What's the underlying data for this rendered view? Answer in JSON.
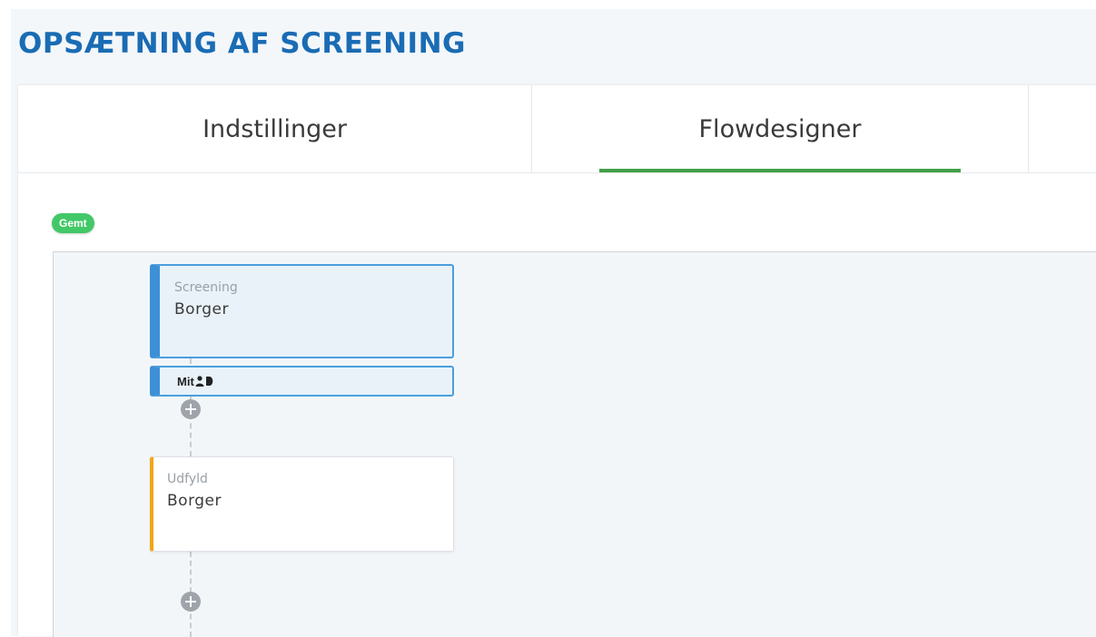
{
  "header": {
    "title": "OPSÆTNING AF SCREENING"
  },
  "tabs": [
    {
      "label": "Indstillinger",
      "active": false
    },
    {
      "label": "Flowdesigner",
      "active": true
    },
    {
      "label": "",
      "active": false
    }
  ],
  "status": {
    "label": "Gemt",
    "color": "#42c867"
  },
  "flow": {
    "nodes": [
      {
        "type": "Screening",
        "name": "Borger",
        "accent": "#3d90d6"
      },
      {
        "type": "Udfyld",
        "name": "Borger",
        "accent": "#f2a516"
      }
    ],
    "auth": {
      "label": "Mit",
      "icon": "mitid-logo-icon"
    },
    "add_icon": "plus-circle-icon"
  },
  "colors": {
    "title": "#1a6cb4",
    "active_tab_underline": "#43a047"
  }
}
